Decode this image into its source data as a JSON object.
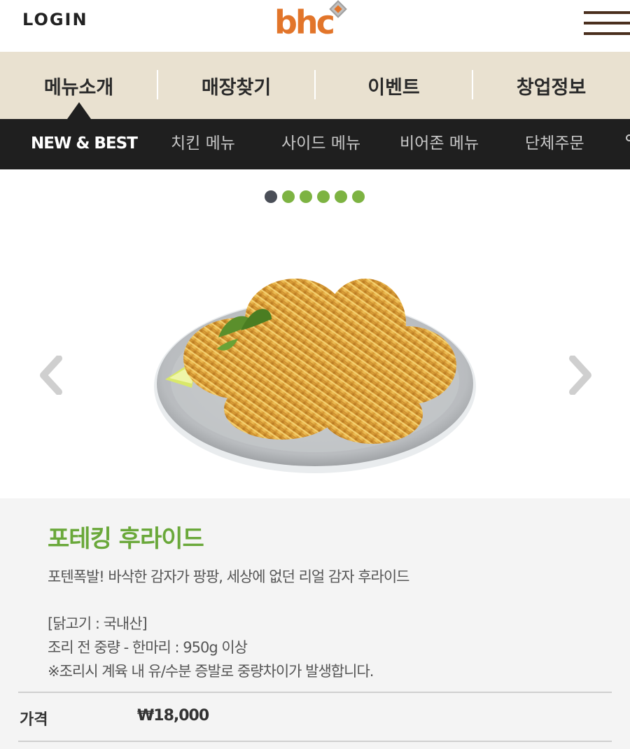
{
  "header": {
    "login_label": "LOGIN",
    "logo_text": "bhc",
    "brand_color": "#e2752a",
    "menu_icon": "hamburger-menu-icon"
  },
  "main_nav": {
    "items": [
      {
        "label": "메뉴소개",
        "active": true
      },
      {
        "label": "매장찾기"
      },
      {
        "label": "이벤트"
      },
      {
        "label": "창업정보"
      }
    ],
    "background": "#e9e1d0"
  },
  "sub_nav": {
    "items": [
      {
        "label": "NEW & BEST",
        "active": true
      },
      {
        "label": "치킨 메뉴"
      },
      {
        "label": "사이드 메뉴"
      },
      {
        "label": "비어존 메뉴"
      },
      {
        "label": "단체주문"
      }
    ],
    "background": "#1f1f1f"
  },
  "slider": {
    "total_slides": 6,
    "active_index": 0,
    "active_color": "#4a4e57",
    "inactive_color": "#7db342",
    "prev_icon": "chevron-left-icon",
    "next_icon": "chevron-right-icon"
  },
  "product": {
    "name": "포테킹 후라이드",
    "name_color": "#6aa83a",
    "description": "포텐폭발! 바삭한 감자가 팡팡, 세상에 없던 리얼 감자 후라이드",
    "notes": [
      "[닭고기 : 국내산]",
      "조리 전 중량 - 한마리 : 950g 이상",
      "※조리시 계육 내 유/수분 증발로 중량차이가 발생합니다."
    ],
    "price_label": "가격",
    "price_value": "₩18,000"
  }
}
